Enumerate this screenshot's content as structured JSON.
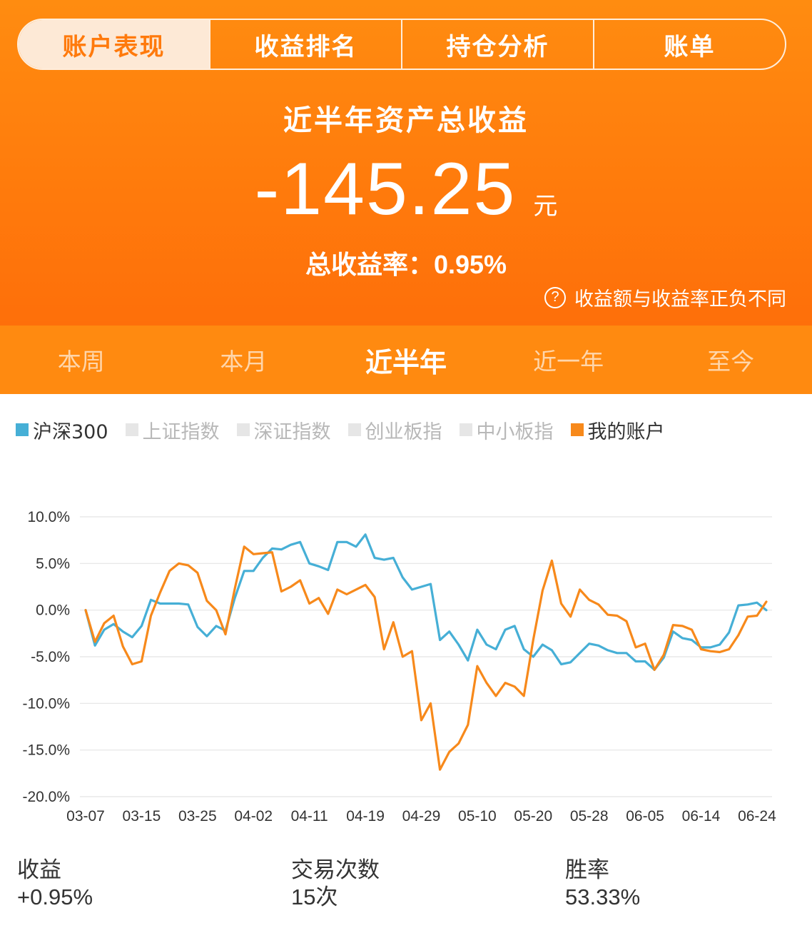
{
  "tabs": [
    {
      "label": "账户表现",
      "active": true
    },
    {
      "label": "收益排名",
      "active": false
    },
    {
      "label": "持仓分析",
      "active": false
    },
    {
      "label": "账单",
      "active": false
    }
  ],
  "summary": {
    "title": "近半年资产总收益",
    "amount": "-145.25",
    "unit": "元",
    "rate_label": "总收益率：",
    "rate_value": "0.95%",
    "note_icon": "question-circle-icon",
    "note_text": "收益额与收益率正负不同"
  },
  "periods": [
    {
      "label": "本周",
      "active": false
    },
    {
      "label": "本月",
      "active": false
    },
    {
      "label": "近半年",
      "active": true
    },
    {
      "label": "近一年",
      "active": false
    },
    {
      "label": "至今",
      "active": false
    }
  ],
  "legend": [
    {
      "label": "沪深300",
      "color": "#46afd6",
      "active": true
    },
    {
      "label": "上证指数",
      "color": "#e6e6e6",
      "active": false
    },
    {
      "label": "深证指数",
      "color": "#e6e6e6",
      "active": false
    },
    {
      "label": "创业板指",
      "color": "#e6e6e6",
      "active": false
    },
    {
      "label": "中小板指",
      "color": "#e6e6e6",
      "active": false
    },
    {
      "label": "我的账户",
      "color": "#f7891b",
      "active": true
    }
  ],
  "chart_data": {
    "type": "line",
    "ylim": [
      -20,
      10
    ],
    "yticks": [
      10,
      5,
      0,
      -5,
      -10,
      -15,
      -20
    ],
    "ytick_labels": [
      "10.0%",
      "5.0%",
      "0.0%",
      "-5.0%",
      "-10.0%",
      "-15.0%",
      "-20.0%"
    ],
    "xtick_labels": [
      "03-07",
      "03-15",
      "03-25",
      "04-02",
      "04-11",
      "04-19",
      "04-29",
      "05-10",
      "05-20",
      "05-28",
      "06-05",
      "06-14",
      "06-24"
    ],
    "xtick_index": [
      0,
      6,
      12,
      18,
      24,
      30,
      36,
      42,
      48,
      54,
      60,
      66,
      72
    ],
    "grid": true,
    "series": [
      {
        "name": "沪深300",
        "color": "#46afd6",
        "values": [
          0,
          -3.8,
          -2.1,
          -1.5,
          -2.3,
          -2.9,
          -1.7,
          1.1,
          0.7,
          0.7,
          0.7,
          0.6,
          -1.8,
          -2.8,
          -1.7,
          -2.2,
          1.3,
          4.2,
          4.2,
          5.6,
          6.6,
          6.5,
          7.0,
          7.3,
          5.0,
          4.7,
          4.3,
          7.3,
          7.3,
          6.8,
          8.1,
          5.6,
          5.4,
          5.6,
          3.5,
          2.2,
          2.5,
          2.8,
          -3.2,
          -2.3,
          -3.7,
          -5.4,
          -2.1,
          -3.7,
          -4.2,
          -2.1,
          -1.7,
          -4.2,
          -5.0,
          -3.7,
          -4.3,
          -5.8,
          -5.6,
          -4.6,
          -3.6,
          -3.8,
          -4.3,
          -4.6,
          -4.6,
          -5.5,
          -5.5,
          -6.4,
          -5.1,
          -2.3,
          -3.0,
          -3.2,
          -4.0,
          -4.0,
          -3.7,
          -2.4,
          0.5,
          0.6,
          0.8,
          0.0
        ]
      },
      {
        "name": "我的账户",
        "color": "#f7891b",
        "values": [
          0,
          -3.4,
          -1.4,
          -0.6,
          -3.9,
          -5.8,
          -5.5,
          -0.6,
          1.9,
          4.2,
          5.0,
          4.8,
          4.0,
          1.0,
          0.0,
          -2.6,
          2.3,
          6.8,
          6.0,
          6.1,
          6.2,
          2.0,
          2.5,
          3.2,
          0.7,
          1.3,
          -0.4,
          2.2,
          1.7,
          2.2,
          2.7,
          1.4,
          -4.2,
          -1.3,
          -5.0,
          -4.4,
          -11.8,
          -10.0,
          -17.1,
          -15.2,
          -14.3,
          -12.3,
          -6.0,
          -7.8,
          -9.2,
          -7.8,
          -8.2,
          -9.2,
          -3.2,
          2.1,
          5.3,
          0.7,
          -0.7,
          2.2,
          1.1,
          0.6,
          -0.5,
          -0.6,
          -1.2,
          -4.0,
          -3.6,
          -6.4,
          -4.8,
          -1.6,
          -1.7,
          -2.1,
          -4.2,
          -4.4,
          -4.5,
          -4.2,
          -2.7,
          -0.7,
          -0.6,
          0.9
        ]
      }
    ]
  },
  "stats": [
    {
      "label": "收益",
      "value": "+0.95%"
    },
    {
      "label": "交易次数",
      "value": "15次"
    },
    {
      "label": "胜率",
      "value": "53.33%"
    }
  ]
}
